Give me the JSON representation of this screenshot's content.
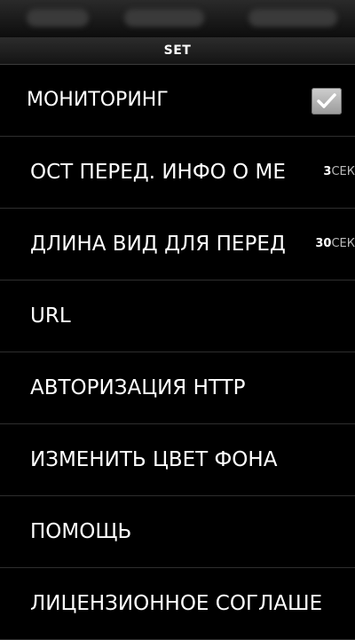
{
  "title_bar": {
    "title": "SET"
  },
  "settings": {
    "items": [
      {
        "label": "МОНИТОРИНГ",
        "checked": true,
        "icon": "checkmark-icon"
      },
      {
        "label": "ОСТ ПЕРЕД. ИНФО О МЕ",
        "value": "3",
        "unit": "СЕК"
      },
      {
        "label": "ДЛИНА ВИД ДЛЯ ПЕРЕД",
        "value": "30",
        "unit": "СЕК"
      },
      {
        "label": "URL"
      },
      {
        "label": "АВТОРИЗАЦИЯ HTTP"
      },
      {
        "label": "ИЗМЕНИТЬ ЦВЕТ ФОНА"
      },
      {
        "label": "ПОМОЩЬ"
      },
      {
        "label": "ЛИЦЕНЗИОННОЕ СОГЛАШЕ"
      }
    ]
  }
}
